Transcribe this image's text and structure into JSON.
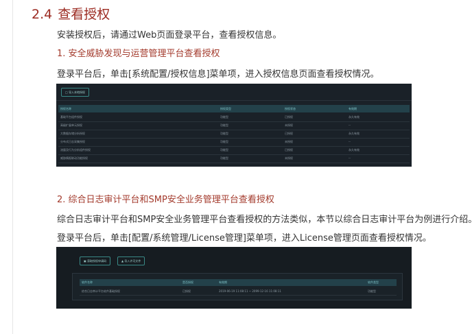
{
  "section": {
    "number": "2.4",
    "title": "查看授权"
  },
  "paragraphs": {
    "intro": "安装授权后，请通过Web页面登录平台，查看授权信息。",
    "sub1_title": "1. 安全威胁发现与运营管理平台查看授权",
    "sub1_instruction": "登录平台后，单击[系统配置/授权信息]菜单项，进入授权信息页面查看授权情况。",
    "sub2_title": "2. 综合日志审计平台和SMP安全业务管理平台查看授权",
    "sub2_text1": "综合日志审计平台和SMP安全业务管理平台查看授权的方法类似，本节以综合日志审计平台为例进行介绍。",
    "sub2_text2": "登录平台后，单击[配置/系统管理/License管理]菜单项，进入License管理页面查看授权情况。"
  },
  "screenshot1": {
    "import_button": "导入本地授权",
    "headers": [
      "授权名称",
      "授权类型",
      "授权状态",
      "有效期"
    ],
    "rows": [
      [
        "基础平台组件授权",
        "功能型",
        "已授权",
        "永久有效"
      ],
      [
        "高级扩展单元授权",
        "功能型",
        "未授权",
        "--"
      ],
      [
        "大数据存储分析授权",
        "功能型",
        "已授权",
        "永久有效"
      ],
      [
        "分布式日志采集授权",
        "功能型",
        "未授权",
        "--"
      ],
      [
        "流量及行为分析组件授权",
        "功能型",
        "已授权",
        "永久有效"
      ],
      [
        "威胁情报联动功能授权",
        "功能型",
        "未授权",
        "--"
      ]
    ]
  },
  "screenshot2": {
    "btn_get": "获取授权申请码",
    "btn_import": "导入许可文件",
    "headers": [
      "软件名称",
      "是否授权",
      "有效期",
      "软件类型"
    ],
    "row": [
      "综合日志审计平台软件基础授权",
      "已授权",
      "2019-06-19 11:08:11 ~ 2099-12-16 11:08:11",
      "功能型"
    ]
  }
}
